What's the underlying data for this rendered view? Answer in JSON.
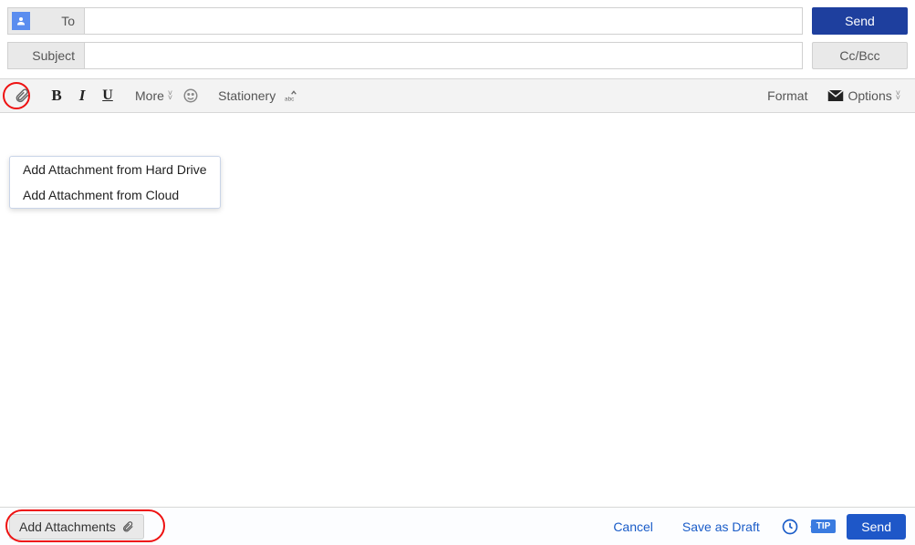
{
  "header": {
    "to_label": "To",
    "subject_label": "Subject",
    "to_value": "",
    "subject_value": "",
    "send_label": "Send",
    "ccbcc_label": "Cc/Bcc"
  },
  "toolbar": {
    "more_label": "More",
    "stationery_label": "Stationery",
    "format_label": "Format",
    "options_label": "Options",
    "bold_glyph": "B",
    "italic_glyph": "I",
    "underline_glyph": "U"
  },
  "attach_menu": {
    "items": [
      {
        "label": "Add Attachment from Hard Drive"
      },
      {
        "label": "Add Attachment from Cloud"
      }
    ]
  },
  "footer": {
    "add_attachments_label": "Add Attachments",
    "cancel_label": "Cancel",
    "save_draft_label": "Save as Draft",
    "tip_label": "TIP",
    "send_label": "Send"
  }
}
